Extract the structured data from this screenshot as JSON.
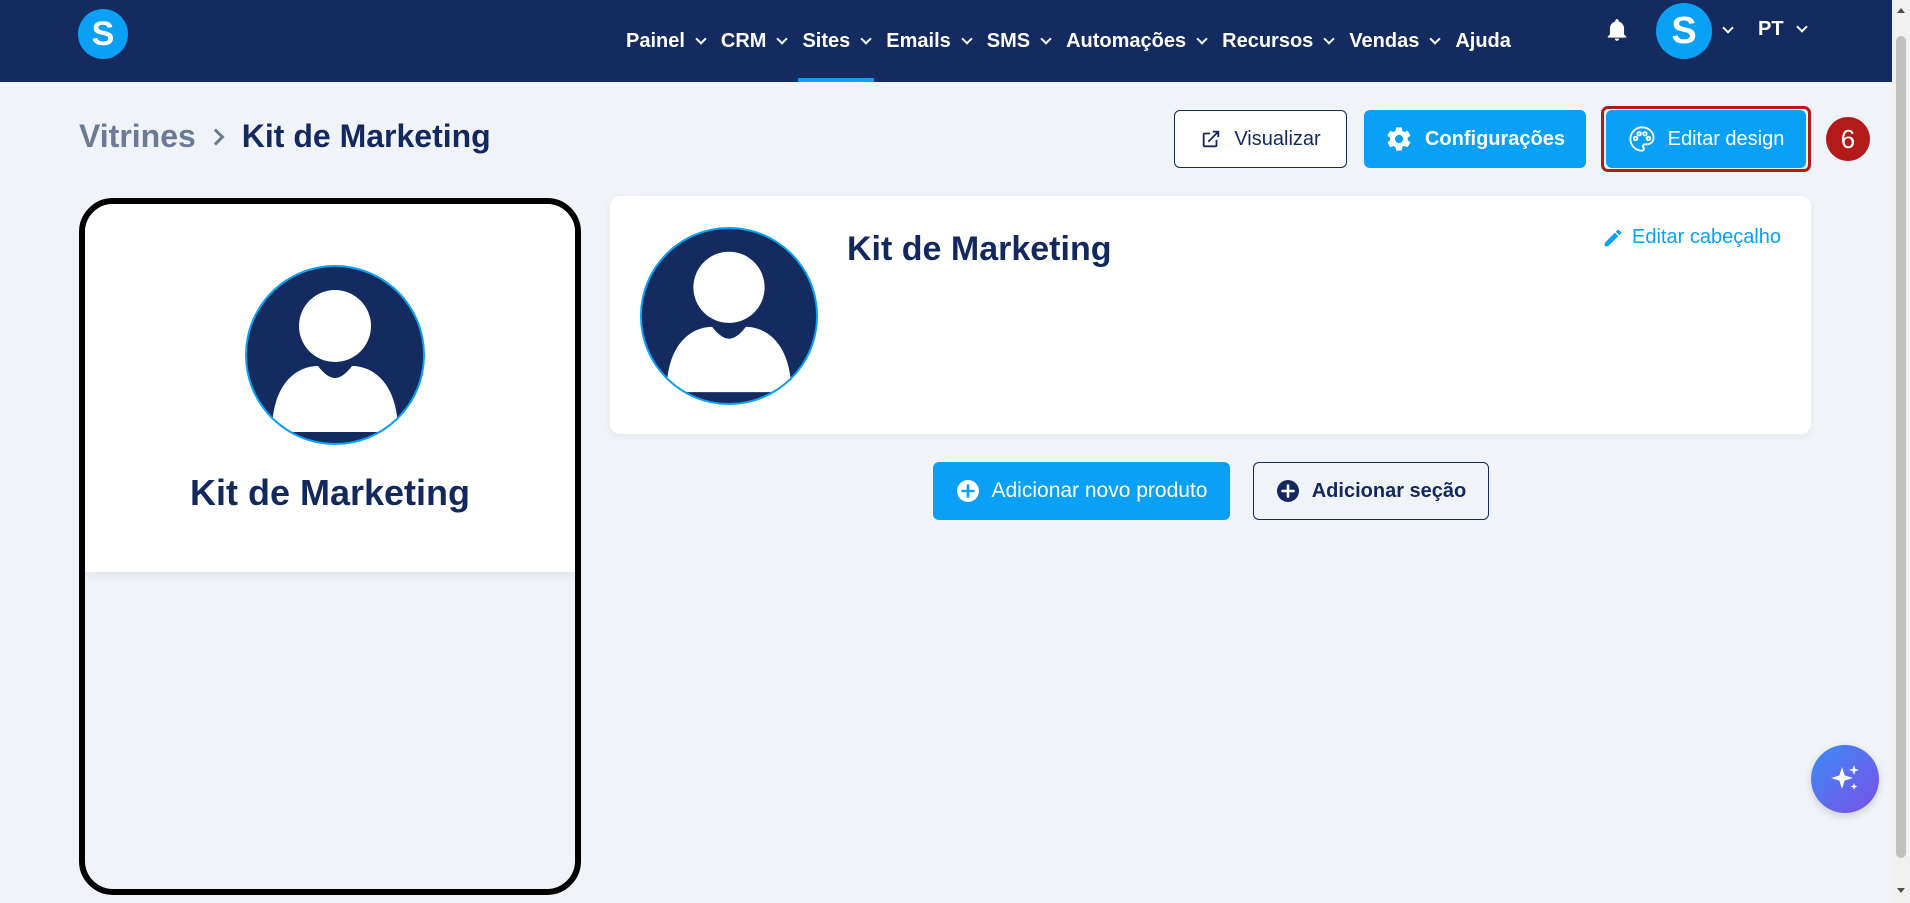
{
  "brand": {
    "logo_letter": "S"
  },
  "nav": {
    "items": [
      {
        "label": "Painel",
        "has_dropdown": true
      },
      {
        "label": "CRM",
        "has_dropdown": true
      },
      {
        "label": "Sites",
        "has_dropdown": true,
        "active": true
      },
      {
        "label": "Emails",
        "has_dropdown": true
      },
      {
        "label": "SMS",
        "has_dropdown": true
      },
      {
        "label": "Automações",
        "has_dropdown": true
      },
      {
        "label": "Recursos",
        "has_dropdown": true
      },
      {
        "label": "Vendas",
        "has_dropdown": true
      },
      {
        "label": "Ajuda",
        "has_dropdown": false
      }
    ],
    "user_avatar_letter": "S",
    "language": "PT"
  },
  "breadcrumb": {
    "parent": "Vitrines",
    "current": "Kit de Marketing"
  },
  "actions": {
    "preview_label": "Visualizar",
    "settings_label": "Configurações",
    "edit_design_label": "Editar design",
    "step_badge": "6"
  },
  "phone_preview": {
    "title": "Kit de Marketing"
  },
  "header_card": {
    "title": "Kit de Marketing",
    "edit_label": "Editar cabeçalho"
  },
  "content_actions": {
    "add_product_label": "Adicionar novo produto",
    "add_section_label": "Adicionar seção"
  },
  "colors": {
    "navy": "#142b5f",
    "accent": "#0aa0f5",
    "highlight": "#b31b1b",
    "background": "#f0f3f8"
  }
}
